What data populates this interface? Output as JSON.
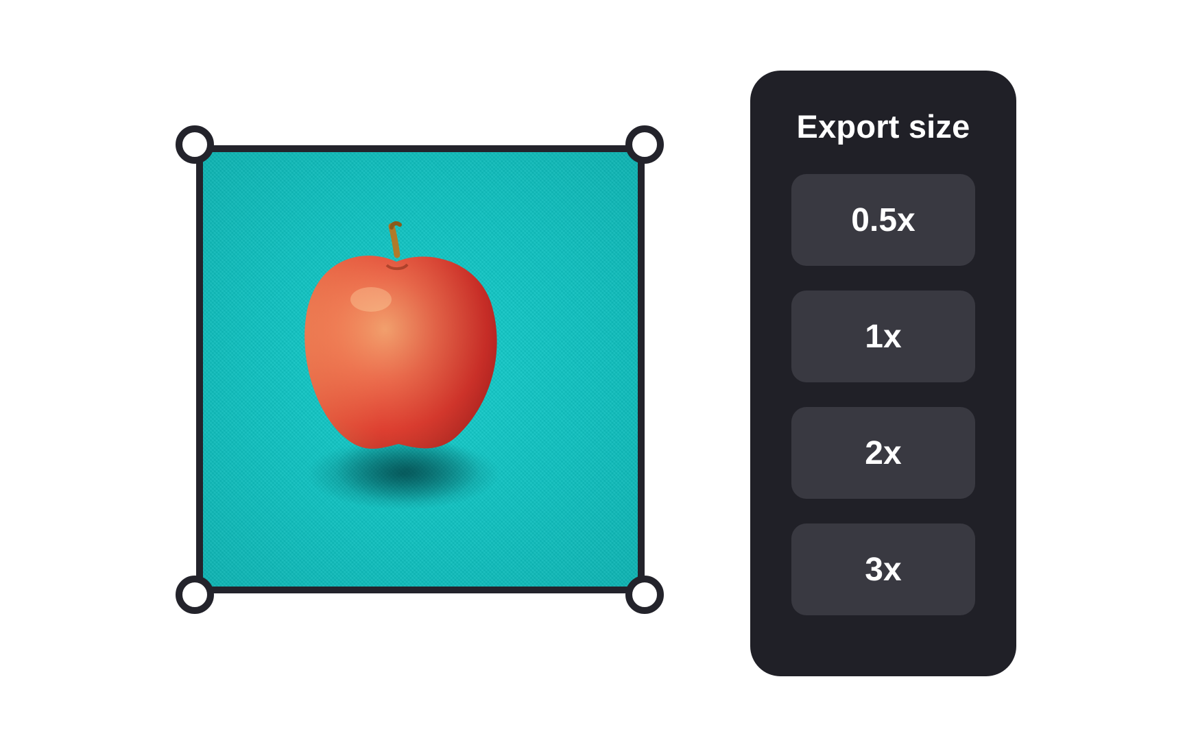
{
  "export_panel": {
    "title": "Export size",
    "options": [
      {
        "label": "0.5x"
      },
      {
        "label": "1x"
      },
      {
        "label": "2x"
      },
      {
        "label": "3x"
      }
    ]
  },
  "canvas": {
    "image_subject": "apple-photo",
    "colors": {
      "frame": "#23232b",
      "background_teal": "#11c4c3",
      "panel": "#202027",
      "button": "#393941",
      "text": "#ffffff"
    }
  }
}
